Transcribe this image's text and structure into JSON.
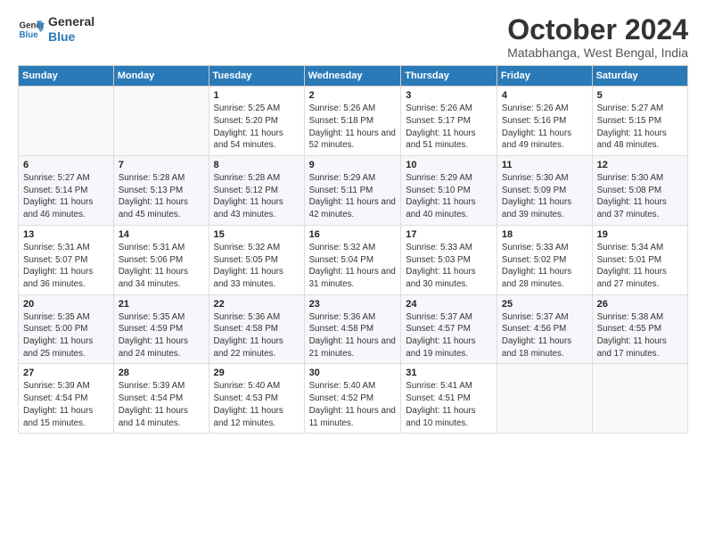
{
  "logo": {
    "line1": "General",
    "line2": "Blue"
  },
  "title": "October 2024",
  "subtitle": "Matabhanga, West Bengal, India",
  "days_header": [
    "Sunday",
    "Monday",
    "Tuesday",
    "Wednesday",
    "Thursday",
    "Friday",
    "Saturday"
  ],
  "weeks": [
    [
      {
        "day": "",
        "info": ""
      },
      {
        "day": "",
        "info": ""
      },
      {
        "day": "1",
        "info": "Sunrise: 5:25 AM\nSunset: 5:20 PM\nDaylight: 11 hours and 54 minutes."
      },
      {
        "day": "2",
        "info": "Sunrise: 5:26 AM\nSunset: 5:18 PM\nDaylight: 11 hours and 52 minutes."
      },
      {
        "day": "3",
        "info": "Sunrise: 5:26 AM\nSunset: 5:17 PM\nDaylight: 11 hours and 51 minutes."
      },
      {
        "day": "4",
        "info": "Sunrise: 5:26 AM\nSunset: 5:16 PM\nDaylight: 11 hours and 49 minutes."
      },
      {
        "day": "5",
        "info": "Sunrise: 5:27 AM\nSunset: 5:15 PM\nDaylight: 11 hours and 48 minutes."
      }
    ],
    [
      {
        "day": "6",
        "info": "Sunrise: 5:27 AM\nSunset: 5:14 PM\nDaylight: 11 hours and 46 minutes."
      },
      {
        "day": "7",
        "info": "Sunrise: 5:28 AM\nSunset: 5:13 PM\nDaylight: 11 hours and 45 minutes."
      },
      {
        "day": "8",
        "info": "Sunrise: 5:28 AM\nSunset: 5:12 PM\nDaylight: 11 hours and 43 minutes."
      },
      {
        "day": "9",
        "info": "Sunrise: 5:29 AM\nSunset: 5:11 PM\nDaylight: 11 hours and 42 minutes."
      },
      {
        "day": "10",
        "info": "Sunrise: 5:29 AM\nSunset: 5:10 PM\nDaylight: 11 hours and 40 minutes."
      },
      {
        "day": "11",
        "info": "Sunrise: 5:30 AM\nSunset: 5:09 PM\nDaylight: 11 hours and 39 minutes."
      },
      {
        "day": "12",
        "info": "Sunrise: 5:30 AM\nSunset: 5:08 PM\nDaylight: 11 hours and 37 minutes."
      }
    ],
    [
      {
        "day": "13",
        "info": "Sunrise: 5:31 AM\nSunset: 5:07 PM\nDaylight: 11 hours and 36 minutes."
      },
      {
        "day": "14",
        "info": "Sunrise: 5:31 AM\nSunset: 5:06 PM\nDaylight: 11 hours and 34 minutes."
      },
      {
        "day": "15",
        "info": "Sunrise: 5:32 AM\nSunset: 5:05 PM\nDaylight: 11 hours and 33 minutes."
      },
      {
        "day": "16",
        "info": "Sunrise: 5:32 AM\nSunset: 5:04 PM\nDaylight: 11 hours and 31 minutes."
      },
      {
        "day": "17",
        "info": "Sunrise: 5:33 AM\nSunset: 5:03 PM\nDaylight: 11 hours and 30 minutes."
      },
      {
        "day": "18",
        "info": "Sunrise: 5:33 AM\nSunset: 5:02 PM\nDaylight: 11 hours and 28 minutes."
      },
      {
        "day": "19",
        "info": "Sunrise: 5:34 AM\nSunset: 5:01 PM\nDaylight: 11 hours and 27 minutes."
      }
    ],
    [
      {
        "day": "20",
        "info": "Sunrise: 5:35 AM\nSunset: 5:00 PM\nDaylight: 11 hours and 25 minutes."
      },
      {
        "day": "21",
        "info": "Sunrise: 5:35 AM\nSunset: 4:59 PM\nDaylight: 11 hours and 24 minutes."
      },
      {
        "day": "22",
        "info": "Sunrise: 5:36 AM\nSunset: 4:58 PM\nDaylight: 11 hours and 22 minutes."
      },
      {
        "day": "23",
        "info": "Sunrise: 5:36 AM\nSunset: 4:58 PM\nDaylight: 11 hours and 21 minutes."
      },
      {
        "day": "24",
        "info": "Sunrise: 5:37 AM\nSunset: 4:57 PM\nDaylight: 11 hours and 19 minutes."
      },
      {
        "day": "25",
        "info": "Sunrise: 5:37 AM\nSunset: 4:56 PM\nDaylight: 11 hours and 18 minutes."
      },
      {
        "day": "26",
        "info": "Sunrise: 5:38 AM\nSunset: 4:55 PM\nDaylight: 11 hours and 17 minutes."
      }
    ],
    [
      {
        "day": "27",
        "info": "Sunrise: 5:39 AM\nSunset: 4:54 PM\nDaylight: 11 hours and 15 minutes."
      },
      {
        "day": "28",
        "info": "Sunrise: 5:39 AM\nSunset: 4:54 PM\nDaylight: 11 hours and 14 minutes."
      },
      {
        "day": "29",
        "info": "Sunrise: 5:40 AM\nSunset: 4:53 PM\nDaylight: 11 hours and 12 minutes."
      },
      {
        "day": "30",
        "info": "Sunrise: 5:40 AM\nSunset: 4:52 PM\nDaylight: 11 hours and 11 minutes."
      },
      {
        "day": "31",
        "info": "Sunrise: 5:41 AM\nSunset: 4:51 PM\nDaylight: 11 hours and 10 minutes."
      },
      {
        "day": "",
        "info": ""
      },
      {
        "day": "",
        "info": ""
      }
    ]
  ]
}
